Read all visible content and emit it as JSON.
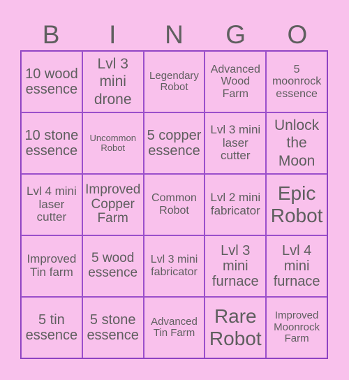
{
  "header": [
    "B",
    "I",
    "N",
    "G",
    "O"
  ],
  "cells": [
    [
      "10 wood essence",
      "Lvl 3 mini drone",
      "Legendary Robot",
      "Advanced Wood Farm",
      "5 moonrock essence"
    ],
    [
      "10 stone essence",
      "Uncommon Robot",
      "5 copper essence",
      "Lvl 3 mini laser cutter",
      "Unlock the Moon"
    ],
    [
      "Lvl 4 mini laser cutter",
      "Improved Copper Farm",
      "Common Robot",
      "Lvl 2 mini fabricator",
      "Epic Robot"
    ],
    [
      "Improved Tin farm",
      "5 wood essence",
      "Lvl 3 mini fabricator",
      "Lvl 3 mini furnace",
      "Lvl 4 mini furnace"
    ],
    [
      "5 tin essence",
      "5 stone essence",
      "Advanced Tin Farm",
      "Rare Robot",
      "Improved Moonrock Farm"
    ]
  ],
  "colors": {
    "background": "#f9c1ec",
    "border": "#8a3fbf",
    "text": "#5f5f5f"
  }
}
